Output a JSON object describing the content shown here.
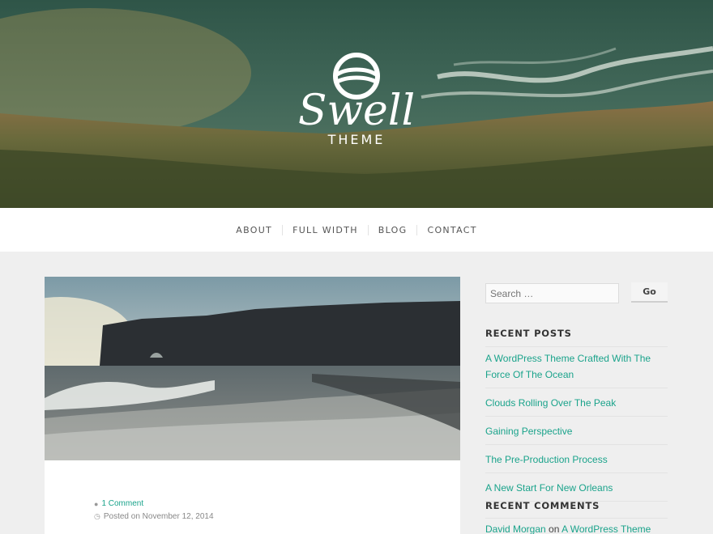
{
  "site": {
    "logo_script": "Swell",
    "logo_sub": "THEME"
  },
  "nav": {
    "items": [
      {
        "label": "ABOUT"
      },
      {
        "label": "FULL WIDTH"
      },
      {
        "label": "BLOG"
      },
      {
        "label": "CONTACT"
      }
    ]
  },
  "post": {
    "comments_label": "1 Comment",
    "posted_on": "Posted on November 12, 2014"
  },
  "sidebar": {
    "search": {
      "placeholder": "Search …",
      "button_label": "Go"
    },
    "recent_posts": {
      "title": "RECENT POSTS",
      "items": [
        "A WordPress Theme Crafted With The Force Of The Ocean",
        "Clouds Rolling Over The Peak",
        "Gaining Perspective",
        "The Pre-Production Process",
        "A New Start For New Orleans"
      ]
    },
    "recent_comments": {
      "title": "RECENT COMMENTS",
      "items": [
        {
          "author": "David Morgan",
          "on": "on",
          "post": "A WordPress Theme"
        }
      ]
    }
  },
  "colors": {
    "accent": "#1aa38b",
    "page_bg": "#efefef"
  },
  "icons": {
    "comment": "comment-icon",
    "clock": "clock-icon"
  }
}
